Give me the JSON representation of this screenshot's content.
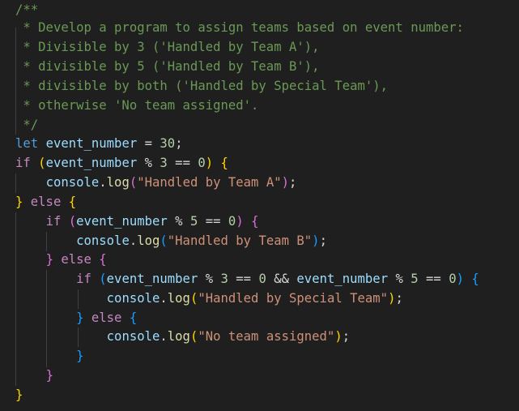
{
  "editor": {
    "language": "javascript",
    "theme_colors": {
      "background": "#1f1f1f",
      "comment": "#6a9955",
      "keyword": "#569cd6",
      "control": "#c586c0",
      "variable": "#9cdcfe",
      "number": "#b5cea8",
      "string": "#ce9178",
      "function": "#dcdcaa",
      "bracket_level_1": "#ffd700",
      "bracket_level_2": "#da70d6",
      "bracket_level_3": "#179fff"
    },
    "lines": [
      [
        {
          "t": "/**",
          "c": "comment"
        }
      ],
      [
        {
          "t": " * Develop a program to assign teams based on event number:",
          "c": "comment"
        }
      ],
      [
        {
          "t": " * Divisible by 3 ('Handled by Team A'),",
          "c": "comment"
        }
      ],
      [
        {
          "t": " * divisible by 5 ('Handled by Team B'),",
          "c": "comment"
        }
      ],
      [
        {
          "t": " * divisible by both ('Handled by Special Team'),",
          "c": "comment"
        }
      ],
      [
        {
          "t": " * otherwise 'No team assigned'.",
          "c": "comment"
        }
      ],
      [
        {
          "t": " */",
          "c": "comment"
        }
      ],
      [
        {
          "t": "let",
          "c": "keyword"
        },
        {
          "t": " ",
          "c": "plain"
        },
        {
          "t": "event_number",
          "c": "variable"
        },
        {
          "t": " = ",
          "c": "plain"
        },
        {
          "t": "30",
          "c": "number"
        },
        {
          "t": ";",
          "c": "plain"
        }
      ],
      [
        {
          "t": "if",
          "c": "control"
        },
        {
          "t": " ",
          "c": "plain"
        },
        {
          "t": "(",
          "c": "b1"
        },
        {
          "t": "event_number",
          "c": "variable"
        },
        {
          "t": " % ",
          "c": "plain"
        },
        {
          "t": "3",
          "c": "number"
        },
        {
          "t": " == ",
          "c": "plain"
        },
        {
          "t": "0",
          "c": "number"
        },
        {
          "t": ")",
          "c": "b1"
        },
        {
          "t": " ",
          "c": "plain"
        },
        {
          "t": "{",
          "c": "b1"
        }
      ],
      [
        {
          "t": "    ",
          "c": "plain"
        },
        {
          "t": "console",
          "c": "variable"
        },
        {
          "t": ".",
          "c": "plain"
        },
        {
          "t": "log",
          "c": "function"
        },
        {
          "t": "(",
          "c": "b2"
        },
        {
          "t": "\"Handled by Team A\"",
          "c": "string"
        },
        {
          "t": ")",
          "c": "b2"
        },
        {
          "t": ";",
          "c": "plain"
        }
      ],
      [
        {
          "t": "}",
          "c": "b1"
        },
        {
          "t": " ",
          "c": "plain"
        },
        {
          "t": "else",
          "c": "control"
        },
        {
          "t": " ",
          "c": "plain"
        },
        {
          "t": "{",
          "c": "b1"
        }
      ],
      [
        {
          "t": "    ",
          "c": "plain"
        },
        {
          "t": "if",
          "c": "control"
        },
        {
          "t": " ",
          "c": "plain"
        },
        {
          "t": "(",
          "c": "b2"
        },
        {
          "t": "event_number",
          "c": "variable"
        },
        {
          "t": " % ",
          "c": "plain"
        },
        {
          "t": "5",
          "c": "number"
        },
        {
          "t": " == ",
          "c": "plain"
        },
        {
          "t": "0",
          "c": "number"
        },
        {
          "t": ")",
          "c": "b2"
        },
        {
          "t": " ",
          "c": "plain"
        },
        {
          "t": "{",
          "c": "b2"
        }
      ],
      [
        {
          "t": "        ",
          "c": "plain"
        },
        {
          "t": "console",
          "c": "variable"
        },
        {
          "t": ".",
          "c": "plain"
        },
        {
          "t": "log",
          "c": "function"
        },
        {
          "t": "(",
          "c": "b3"
        },
        {
          "t": "\"Handled by Team B\"",
          "c": "string"
        },
        {
          "t": ")",
          "c": "b3"
        },
        {
          "t": ";",
          "c": "plain"
        }
      ],
      [
        {
          "t": "    ",
          "c": "plain"
        },
        {
          "t": "}",
          "c": "b2"
        },
        {
          "t": " ",
          "c": "plain"
        },
        {
          "t": "else",
          "c": "control"
        },
        {
          "t": " ",
          "c": "plain"
        },
        {
          "t": "{",
          "c": "b2"
        }
      ],
      [
        {
          "t": "        ",
          "c": "plain"
        },
        {
          "t": "if",
          "c": "control"
        },
        {
          "t": " ",
          "c": "plain"
        },
        {
          "t": "(",
          "c": "b3"
        },
        {
          "t": "event_number",
          "c": "variable"
        },
        {
          "t": " % ",
          "c": "plain"
        },
        {
          "t": "3",
          "c": "number"
        },
        {
          "t": " == ",
          "c": "plain"
        },
        {
          "t": "0",
          "c": "number"
        },
        {
          "t": " && ",
          "c": "plain"
        },
        {
          "t": "event_number",
          "c": "variable"
        },
        {
          "t": " % ",
          "c": "plain"
        },
        {
          "t": "5",
          "c": "number"
        },
        {
          "t": " == ",
          "c": "plain"
        },
        {
          "t": "0",
          "c": "number"
        },
        {
          "t": ")",
          "c": "b3"
        },
        {
          "t": " ",
          "c": "plain"
        },
        {
          "t": "{",
          "c": "b3"
        }
      ],
      [
        {
          "t": "            ",
          "c": "plain"
        },
        {
          "t": "console",
          "c": "variable"
        },
        {
          "t": ".",
          "c": "plain"
        },
        {
          "t": "log",
          "c": "function"
        },
        {
          "t": "(",
          "c": "b1"
        },
        {
          "t": "\"Handled by Special Team\"",
          "c": "string"
        },
        {
          "t": ")",
          "c": "b1"
        },
        {
          "t": ";",
          "c": "plain"
        }
      ],
      [
        {
          "t": "        ",
          "c": "plain"
        },
        {
          "t": "}",
          "c": "b3"
        },
        {
          "t": " ",
          "c": "plain"
        },
        {
          "t": "else",
          "c": "control"
        },
        {
          "t": " ",
          "c": "plain"
        },
        {
          "t": "{",
          "c": "b3"
        }
      ],
      [
        {
          "t": "            ",
          "c": "plain"
        },
        {
          "t": "console",
          "c": "variable"
        },
        {
          "t": ".",
          "c": "plain"
        },
        {
          "t": "log",
          "c": "function"
        },
        {
          "t": "(",
          "c": "b1"
        },
        {
          "t": "\"No team assigned\"",
          "c": "string"
        },
        {
          "t": ")",
          "c": "b1"
        },
        {
          "t": ";",
          "c": "plain"
        }
      ],
      [
        {
          "t": "        ",
          "c": "plain"
        },
        {
          "t": "}",
          "c": "b3"
        }
      ],
      [
        {
          "t": "    ",
          "c": "plain"
        },
        {
          "t": "}",
          "c": "b2"
        }
      ],
      [
        {
          "t": "}",
          "c": "b1"
        }
      ]
    ]
  }
}
